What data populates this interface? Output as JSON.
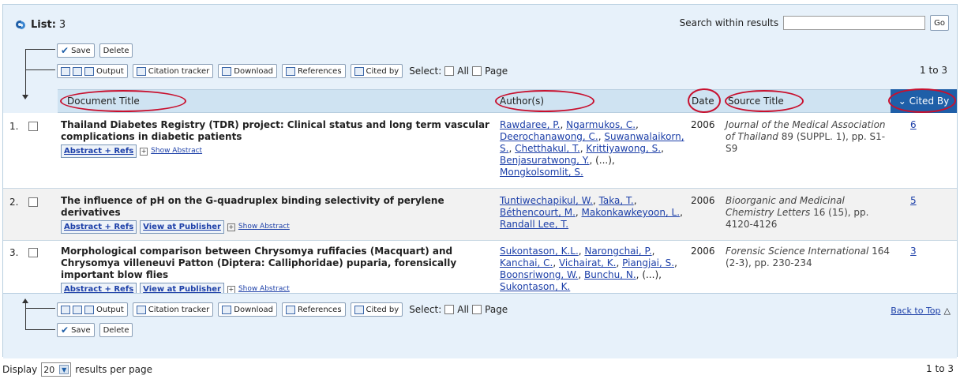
{
  "list": {
    "label": "List:",
    "count": "3"
  },
  "search": {
    "label": "Search within results",
    "value": "",
    "go_label": "Go"
  },
  "toolbar": {
    "save": "Save",
    "delete": "Delete",
    "output": "Output",
    "citation_tracker": "Citation tracker",
    "download": "Download",
    "references": "References",
    "cited_by": "Cited by",
    "select_label": "Select:",
    "all": "All",
    "page": "Page",
    "range": "1 to 3"
  },
  "table_headers": {
    "document_title": "Document Title",
    "authors": "Author(s)",
    "date": "Date",
    "source_title": "Source Title",
    "cited_by": "Cited By"
  },
  "records": [
    {
      "num": "1.",
      "title": "Thailand Diabetes Registry (TDR) project: Clinical status and long term vascular complications in diabetic patients",
      "links": [
        "Abstract + Refs"
      ],
      "show_abstract": "Show Abstract",
      "authors": [
        "Rawdaree, P.",
        "Ngarmukos, C.",
        "Deerochanawong, C.",
        "Suwanwalaikorn, S.",
        "Chetthakul, T.",
        "Krittiyawong, S.",
        "Benjasuratwong, Y.",
        "(...)",
        "Mongkolsomlit, S."
      ],
      "year": "2006",
      "source_italic": "Journal of the Medical Association of Thailand",
      "source_rest": " 89 (SUPPL. 1), pp. S1-S9",
      "cited": "6"
    },
    {
      "num": "2.",
      "title": "The influence of pH on the G-quadruplex binding selectivity of perylene derivatives",
      "links": [
        "Abstract + Refs",
        "View at Publisher"
      ],
      "show_abstract": "Show Abstract",
      "authors": [
        "Tuntiwechapikul, W.",
        "Taka, T.",
        "Béthencourt, M.",
        "Makonkawkeyoon, L.",
        "Randall Lee, T."
      ],
      "year": "2006",
      "source_italic": "Bioorganic and Medicinal Chemistry Letters",
      "source_rest": " 16 (15), pp. 4120-4126",
      "cited": "5"
    },
    {
      "num": "3.",
      "title": "Morphological comparison between Chrysomya rufifacies (Macquart) and Chrysomya villeneuvi Patton (Diptera: Calliphoridae) puparia, forensically important blow flies",
      "links": [
        "Abstract + Refs",
        "View at Publisher"
      ],
      "show_abstract": "Show Abstract",
      "authors": [
        "Sukontason, K.L.",
        "Narongchai, P.",
        "Kanchai, C.",
        "Vichairat, K.",
        "Piangjai, S.",
        "Boonsriwong, W.",
        "Bunchu, N.",
        "(...)",
        "Sukontason, K."
      ],
      "year": "2006",
      "source_italic": "Forensic Science International",
      "source_rest": " 164 (2-3), pp. 230-234",
      "cited": "3"
    }
  ],
  "bottom": {
    "back_to_top": "Back to Top"
  },
  "footer": {
    "display": "Display",
    "per_page_value": "20",
    "results_per_page": "results per page",
    "range": "1 to 3"
  },
  "colors": {
    "header_bg": "#cfe3f2",
    "bar_bg": "#e7f1fa",
    "accent": "#1f5fa8",
    "highlight_circle": "#c8102e"
  }
}
